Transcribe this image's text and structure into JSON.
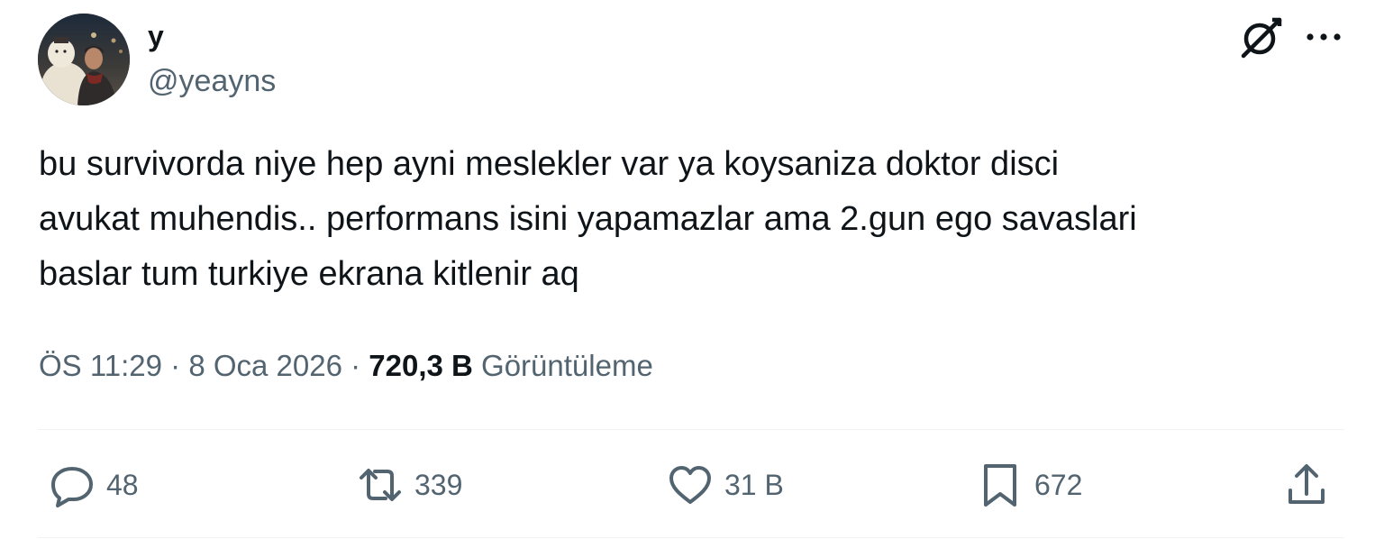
{
  "author": {
    "display_name": "y",
    "handle": "@yeayns"
  },
  "tweet": {
    "text": "bu survivorda niye hep ayni meslekler var ya koysaniza doktor disci\navukat muhendis.. performans isini yapamazlar ama 2.gun ego savaslari\nbaslar tum turkiye ekrana kitlenir aq"
  },
  "meta": {
    "time": "ÖS 11:29",
    "separator": " · ",
    "date": "8 Oca 2026",
    "views_count": "720,3 B",
    "views_label": "Görüntüleme"
  },
  "actions": {
    "replies": "48",
    "reposts": "339",
    "likes": "31 B",
    "bookmarks": "672"
  },
  "icons": {
    "grok": "grok-icon",
    "more": "more-icon",
    "reply": "reply-icon",
    "repost": "repost-icon",
    "like": "like-icon",
    "bookmark": "bookmark-icon",
    "share": "share-icon"
  },
  "colors": {
    "text": "#0f1419",
    "secondary": "#536471",
    "divider": "#eff3f4"
  }
}
